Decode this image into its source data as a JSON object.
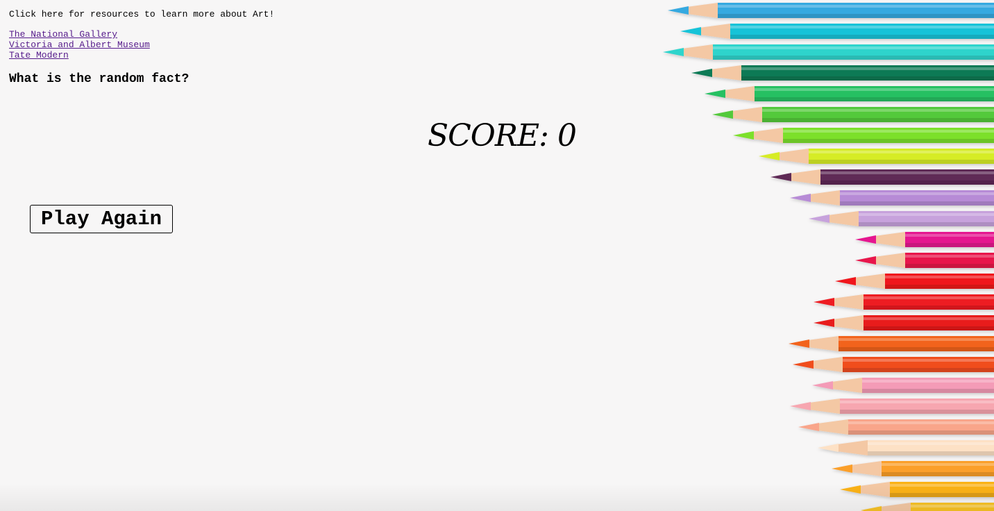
{
  "page": {
    "intro_text": "Click here for resources to learn more about Art!",
    "links": [
      {
        "label": "The National Gallery"
      },
      {
        "label": "Victoria and Albert Museum"
      },
      {
        "label": "Tate Modern"
      }
    ],
    "question": "What is the random fact?",
    "score_text": "SCORE: 0",
    "play_again_label": "Play Again"
  },
  "colors": {
    "background": "#f7f6f6",
    "visited_link": "#551a8b",
    "text": "#000000"
  },
  "background_image": {
    "icon": "colored-pencils-image",
    "pencil_colors": [
      "#36a9e0",
      "#19c3d8",
      "#2fd4cc",
      "#0c7a55",
      "#27c062",
      "#52c93a",
      "#7be02c",
      "#d6ec26",
      "#5e2a57",
      "#b78bd6",
      "#c7a2dc",
      "#e5168f",
      "#e8154b",
      "#f0171d",
      "#ee1b22",
      "#e81c1d",
      "#f2641a",
      "#f04d1f",
      "#f49bb7",
      "#f7a6b0",
      "#f9a58a",
      "#fde1c5",
      "#fb9f2a",
      "#fbb217",
      "#f9c326"
    ]
  }
}
